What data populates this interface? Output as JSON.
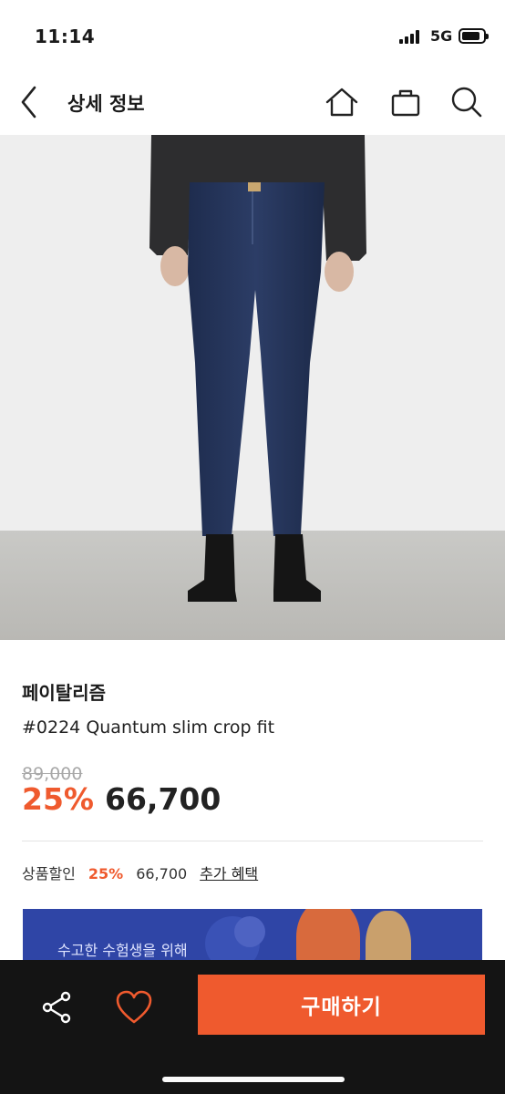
{
  "status_bar": {
    "time": "11:14",
    "network": "5G"
  },
  "header": {
    "title": "상세 정보",
    "icons": [
      "back-arrow-icon",
      "home-icon",
      "shopping-bag-icon",
      "search-icon"
    ]
  },
  "product": {
    "brand": "페이탈리즘",
    "name": "#0224 Quantum slim crop fit",
    "original_price": "89,000",
    "discount_rate": "25%",
    "sale_price": "66,700"
  },
  "benefit": {
    "label": "상품할인",
    "rate": "25%",
    "price": "66,700",
    "link": "추가 혜택"
  },
  "banner": {
    "text": "수고한 수험생을 위해"
  },
  "bottom_bar": {
    "buy_label": "구매하기",
    "icons": [
      "share-icon",
      "heart-icon"
    ]
  },
  "colors": {
    "accent": "#ef5a2e",
    "banner": "#2f45a6",
    "bottom_bar": "#141414"
  }
}
